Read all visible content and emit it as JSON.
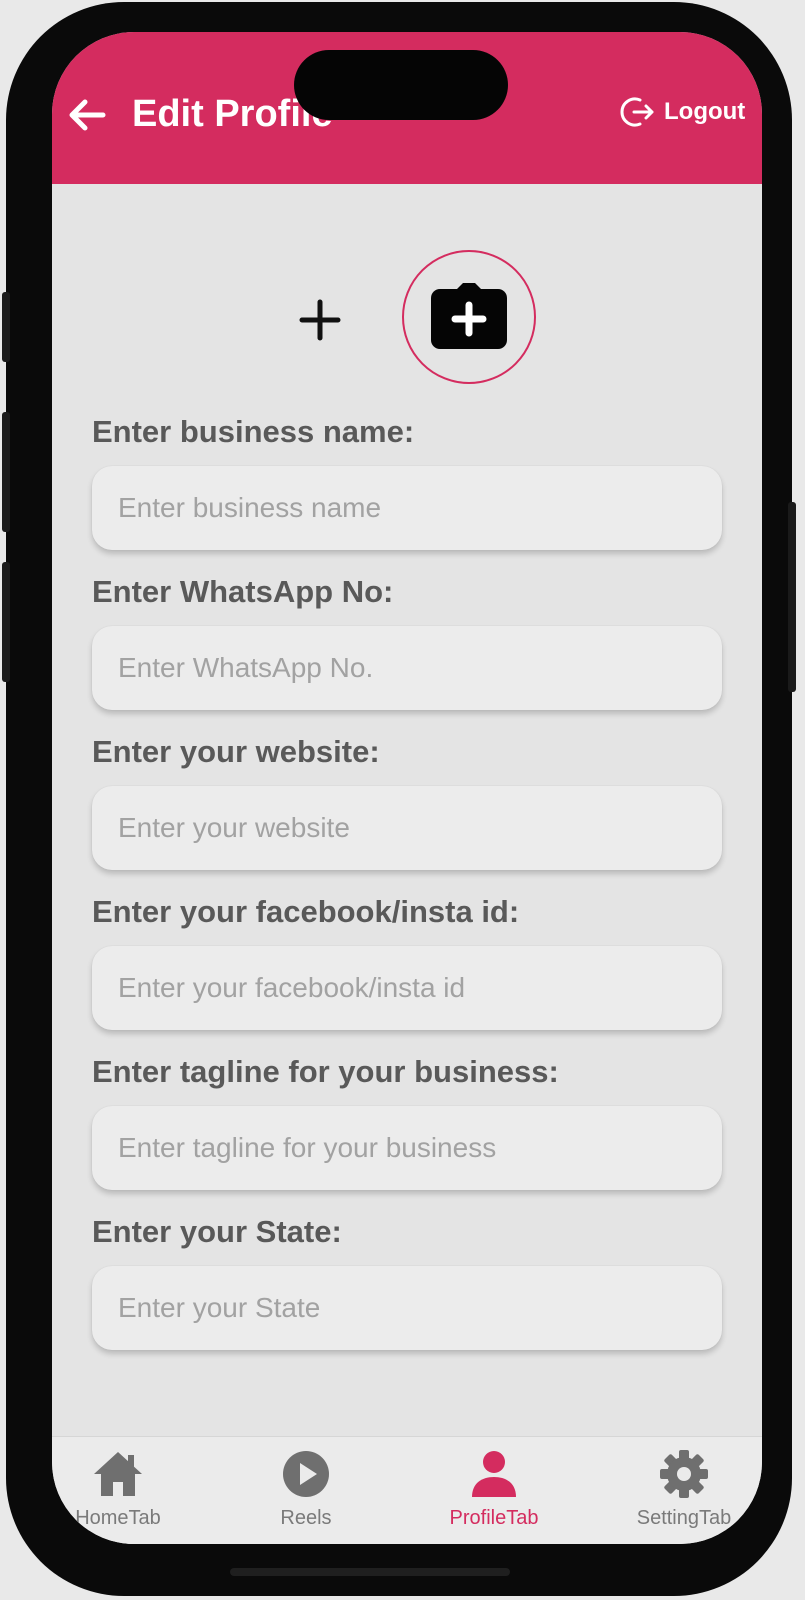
{
  "colors": {
    "accent": "#d42c5f",
    "background": "#e4e4e4",
    "label": "#595959",
    "placeholder": "#a2a2a2",
    "nav_inactive": "#7a7a7a"
  },
  "appbar": {
    "title": "Edit Profile",
    "back_icon": "arrow-left-icon",
    "logout_label": "Logout",
    "logout_icon": "logout-icon"
  },
  "avatar": {
    "add_icon": "plus-icon",
    "camera_icon": "camera-plus-icon"
  },
  "form": {
    "fields": [
      {
        "label": "Enter business name:",
        "placeholder": "Enter business name"
      },
      {
        "label": "Enter WhatsApp No:",
        "placeholder": "Enter WhatsApp No."
      },
      {
        "label": "Enter your website:",
        "placeholder": "Enter your website"
      },
      {
        "label": "Enter your facebook/insta id:",
        "placeholder": "Enter your facebook/insta id"
      },
      {
        "label": "Enter tagline for your business:",
        "placeholder": "Enter tagline for your business"
      },
      {
        "label": "Enter your State:",
        "placeholder": "Enter your State"
      }
    ]
  },
  "bottom_nav": {
    "items": [
      {
        "label": "HomeTab",
        "icon": "home-icon",
        "active": false
      },
      {
        "label": "Reels",
        "icon": "play-circle-icon",
        "active": false
      },
      {
        "label": "ProfileTab",
        "icon": "person-icon",
        "active": true
      },
      {
        "label": "SettingTab",
        "icon": "gear-icon",
        "active": false
      }
    ]
  }
}
